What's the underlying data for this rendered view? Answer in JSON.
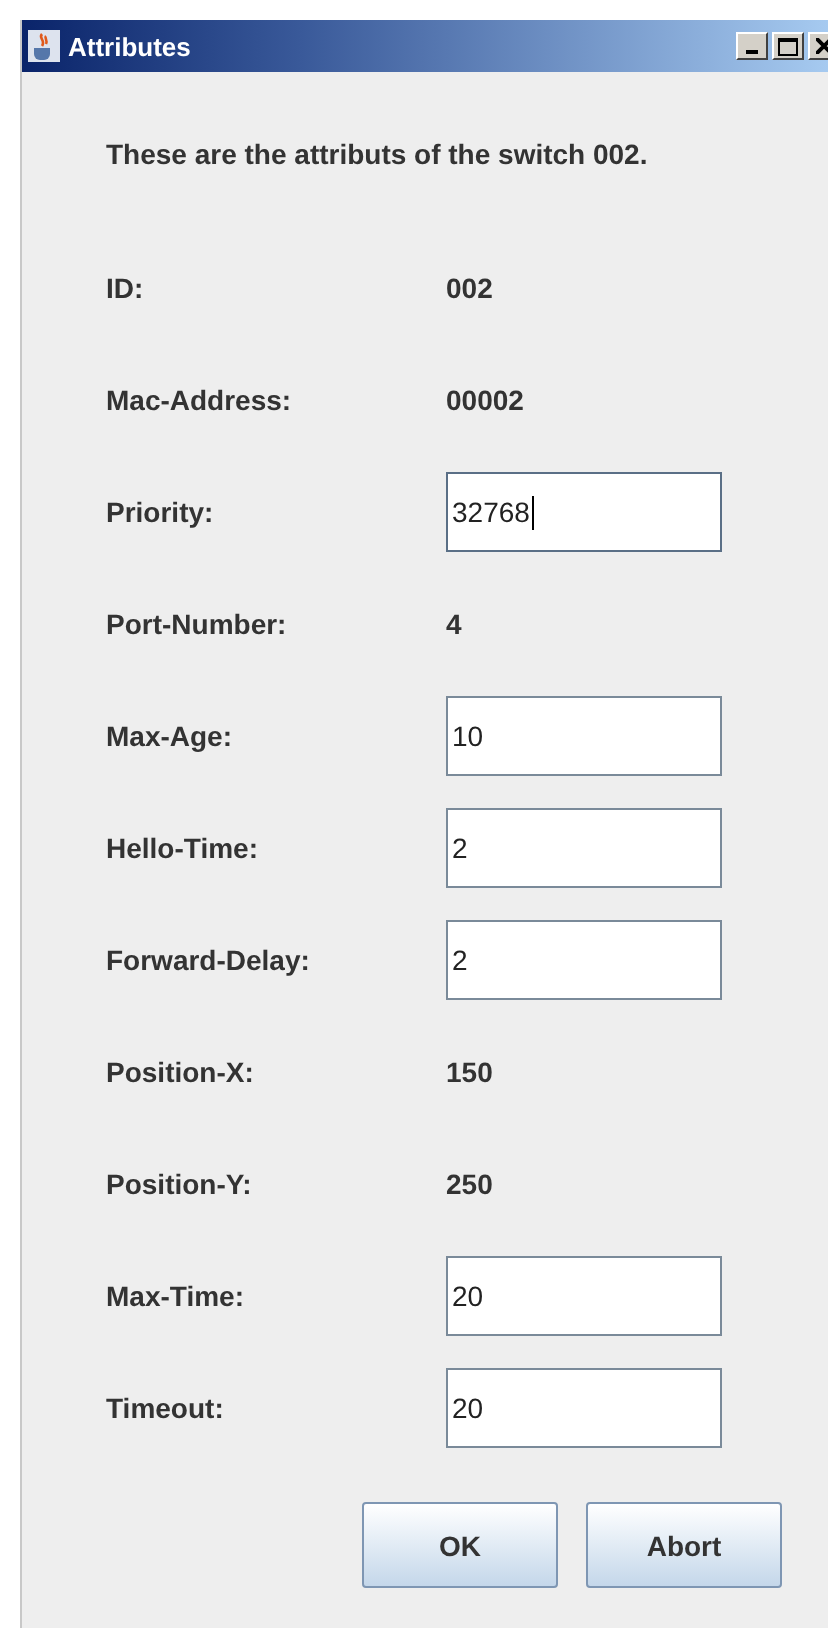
{
  "window": {
    "title": "Attributes"
  },
  "message": "These are the attributs of the switch 002.",
  "rows": [
    {
      "kind": "text",
      "label": "ID:",
      "value": "002"
    },
    {
      "kind": "text",
      "label": "Mac-Address:",
      "value": "00002"
    },
    {
      "kind": "field",
      "label": "Priority:",
      "value": "32768",
      "focused": true
    },
    {
      "kind": "text",
      "label": "Port-Number:",
      "value": "4"
    },
    {
      "kind": "field",
      "label": "Max-Age:",
      "value": "10",
      "focused": false
    },
    {
      "kind": "field",
      "label": "Hello-Time:",
      "value": "2",
      "focused": false
    },
    {
      "kind": "field",
      "label": "Forward-Delay:",
      "value": "2",
      "focused": false
    },
    {
      "kind": "text",
      "label": "Position-X:",
      "value": "150"
    },
    {
      "kind": "text",
      "label": "Position-Y:",
      "value": "250"
    },
    {
      "kind": "field",
      "label": "Max-Time:",
      "value": "20",
      "focused": false
    },
    {
      "kind": "field",
      "label": "Timeout:",
      "value": "20",
      "focused": false
    }
  ],
  "buttons": [
    "OK",
    "Abort"
  ]
}
